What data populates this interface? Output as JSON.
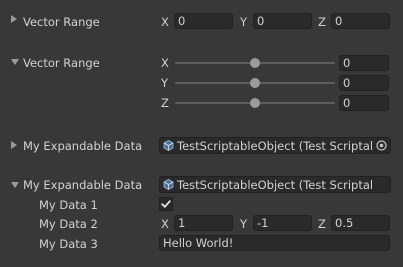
{
  "vector_collapsed": {
    "label": "Vector Range",
    "x_label": "X",
    "x_value": "0",
    "y_label": "Y",
    "y_value": "0",
    "z_label": "Z",
    "z_value": "0"
  },
  "vector_expanded": {
    "label": "Vector Range",
    "rows": [
      {
        "axis": "X",
        "value": "0",
        "slider_fraction": 0.5
      },
      {
        "axis": "Y",
        "value": "0",
        "slider_fraction": 0.5
      },
      {
        "axis": "Z",
        "value": "0",
        "slider_fraction": 0.5
      }
    ]
  },
  "expandable_collapsed": {
    "label": "My Expandable Data",
    "object_text": "TestScriptableObject (Test Scriptal",
    "icon": "scriptable-object-icon",
    "picker_icon": "object-picker-icon"
  },
  "expandable_expanded": {
    "label": "My Expandable Data",
    "object_text": "TestScriptableObject (Test Scriptal",
    "data1_label": "My Data 1",
    "data1_checked": true,
    "data2_label": "My Data 2",
    "data2_x_label": "X",
    "data2_x": "1",
    "data2_y_label": "Y",
    "data2_y": "-1",
    "data2_z_label": "Z",
    "data2_z": "0.5",
    "data3_label": "My Data 3",
    "data3_value": "Hello World!"
  },
  "colors": {
    "background": "#383838",
    "field": "#2a2a2a",
    "text": "#d2d2d2"
  }
}
